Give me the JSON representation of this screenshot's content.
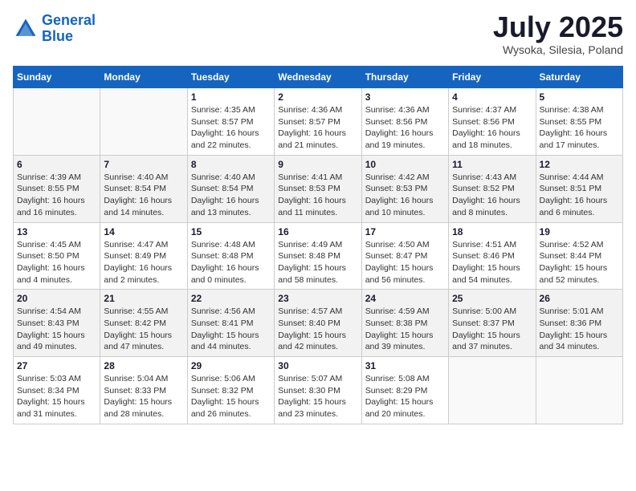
{
  "header": {
    "logo_line1": "General",
    "logo_line2": "Blue",
    "month": "July 2025",
    "location": "Wysoka, Silesia, Poland"
  },
  "days_of_week": [
    "Sunday",
    "Monday",
    "Tuesday",
    "Wednesday",
    "Thursday",
    "Friday",
    "Saturday"
  ],
  "weeks": [
    [
      {
        "day": "",
        "info": ""
      },
      {
        "day": "",
        "info": ""
      },
      {
        "day": "1",
        "info": "Sunrise: 4:35 AM\nSunset: 8:57 PM\nDaylight: 16 hours and 22 minutes."
      },
      {
        "day": "2",
        "info": "Sunrise: 4:36 AM\nSunset: 8:57 PM\nDaylight: 16 hours and 21 minutes."
      },
      {
        "day": "3",
        "info": "Sunrise: 4:36 AM\nSunset: 8:56 PM\nDaylight: 16 hours and 19 minutes."
      },
      {
        "day": "4",
        "info": "Sunrise: 4:37 AM\nSunset: 8:56 PM\nDaylight: 16 hours and 18 minutes."
      },
      {
        "day": "5",
        "info": "Sunrise: 4:38 AM\nSunset: 8:55 PM\nDaylight: 16 hours and 17 minutes."
      }
    ],
    [
      {
        "day": "6",
        "info": "Sunrise: 4:39 AM\nSunset: 8:55 PM\nDaylight: 16 hours and 16 minutes."
      },
      {
        "day": "7",
        "info": "Sunrise: 4:40 AM\nSunset: 8:54 PM\nDaylight: 16 hours and 14 minutes."
      },
      {
        "day": "8",
        "info": "Sunrise: 4:40 AM\nSunset: 8:54 PM\nDaylight: 16 hours and 13 minutes."
      },
      {
        "day": "9",
        "info": "Sunrise: 4:41 AM\nSunset: 8:53 PM\nDaylight: 16 hours and 11 minutes."
      },
      {
        "day": "10",
        "info": "Sunrise: 4:42 AM\nSunset: 8:53 PM\nDaylight: 16 hours and 10 minutes."
      },
      {
        "day": "11",
        "info": "Sunrise: 4:43 AM\nSunset: 8:52 PM\nDaylight: 16 hours and 8 minutes."
      },
      {
        "day": "12",
        "info": "Sunrise: 4:44 AM\nSunset: 8:51 PM\nDaylight: 16 hours and 6 minutes."
      }
    ],
    [
      {
        "day": "13",
        "info": "Sunrise: 4:45 AM\nSunset: 8:50 PM\nDaylight: 16 hours and 4 minutes."
      },
      {
        "day": "14",
        "info": "Sunrise: 4:47 AM\nSunset: 8:49 PM\nDaylight: 16 hours and 2 minutes."
      },
      {
        "day": "15",
        "info": "Sunrise: 4:48 AM\nSunset: 8:48 PM\nDaylight: 16 hours and 0 minutes."
      },
      {
        "day": "16",
        "info": "Sunrise: 4:49 AM\nSunset: 8:48 PM\nDaylight: 15 hours and 58 minutes."
      },
      {
        "day": "17",
        "info": "Sunrise: 4:50 AM\nSunset: 8:47 PM\nDaylight: 15 hours and 56 minutes."
      },
      {
        "day": "18",
        "info": "Sunrise: 4:51 AM\nSunset: 8:46 PM\nDaylight: 15 hours and 54 minutes."
      },
      {
        "day": "19",
        "info": "Sunrise: 4:52 AM\nSunset: 8:44 PM\nDaylight: 15 hours and 52 minutes."
      }
    ],
    [
      {
        "day": "20",
        "info": "Sunrise: 4:54 AM\nSunset: 8:43 PM\nDaylight: 15 hours and 49 minutes."
      },
      {
        "day": "21",
        "info": "Sunrise: 4:55 AM\nSunset: 8:42 PM\nDaylight: 15 hours and 47 minutes."
      },
      {
        "day": "22",
        "info": "Sunrise: 4:56 AM\nSunset: 8:41 PM\nDaylight: 15 hours and 44 minutes."
      },
      {
        "day": "23",
        "info": "Sunrise: 4:57 AM\nSunset: 8:40 PM\nDaylight: 15 hours and 42 minutes."
      },
      {
        "day": "24",
        "info": "Sunrise: 4:59 AM\nSunset: 8:38 PM\nDaylight: 15 hours and 39 minutes."
      },
      {
        "day": "25",
        "info": "Sunrise: 5:00 AM\nSunset: 8:37 PM\nDaylight: 15 hours and 37 minutes."
      },
      {
        "day": "26",
        "info": "Sunrise: 5:01 AM\nSunset: 8:36 PM\nDaylight: 15 hours and 34 minutes."
      }
    ],
    [
      {
        "day": "27",
        "info": "Sunrise: 5:03 AM\nSunset: 8:34 PM\nDaylight: 15 hours and 31 minutes."
      },
      {
        "day": "28",
        "info": "Sunrise: 5:04 AM\nSunset: 8:33 PM\nDaylight: 15 hours and 28 minutes."
      },
      {
        "day": "29",
        "info": "Sunrise: 5:06 AM\nSunset: 8:32 PM\nDaylight: 15 hours and 26 minutes."
      },
      {
        "day": "30",
        "info": "Sunrise: 5:07 AM\nSunset: 8:30 PM\nDaylight: 15 hours and 23 minutes."
      },
      {
        "day": "31",
        "info": "Sunrise: 5:08 AM\nSunset: 8:29 PM\nDaylight: 15 hours and 20 minutes."
      },
      {
        "day": "",
        "info": ""
      },
      {
        "day": "",
        "info": ""
      }
    ]
  ]
}
